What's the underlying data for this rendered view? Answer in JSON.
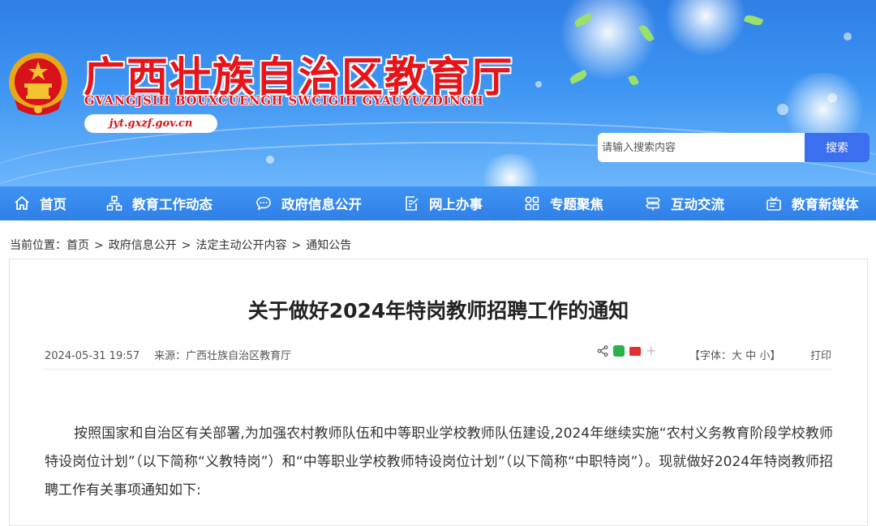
{
  "header": {
    "title": "广西壮族自治区教育厅",
    "subtitle": "GVANGJSIH BOUXCUENGH SWCIGIH GYAUYUZDINGH",
    "url": "jyt.gxzf.gov.cn"
  },
  "search": {
    "placeholder": "请输入搜索内容",
    "button_label": "搜索"
  },
  "nav": {
    "items": [
      {
        "label": "首页",
        "icon": "home-icon"
      },
      {
        "label": "教育工作动态",
        "icon": "network-icon"
      },
      {
        "label": "政府信息公开",
        "icon": "chat-bubble-icon"
      },
      {
        "label": "网上办事",
        "icon": "edit-document-icon"
      },
      {
        "label": "专题聚焦",
        "icon": "grid-icon"
      },
      {
        "label": "互动交流",
        "icon": "sign-icon"
      },
      {
        "label": "教育新媒体",
        "icon": "media-icon"
      }
    ]
  },
  "breadcrumb": {
    "prefix": "当前位置：",
    "items": [
      "首页",
      "政府信息公开",
      "法定主动公开内容",
      "通知公告"
    ],
    "separator": ">"
  },
  "article": {
    "title": "关于做好2024年特岗教师招聘工作的通知",
    "datetime": "2024-05-31 19:57",
    "source_label": "来源：",
    "source": "广西壮族自治区教育厅",
    "font_size_label": "【字体：",
    "font_large": "大",
    "font_medium": "中",
    "font_small": "小",
    "font_size_end": "】",
    "print_label": "打印",
    "body": "按照国家和自治区有关部署,为加强农村教师队伍和中等职业学校教师队伍建设,2024年继续实施“农村义务教育阶段学校教师特设岗位计划”（以下简称“义教特岗”）和“中等职业学校教师特设岗位计划”（以下简称“中职特岗”）。现就做好2024年特岗教师招聘工作有关事项通知如下:"
  },
  "colors": {
    "banner": "#3d94f2",
    "nav": "#2f80e8",
    "title_red": "#e8141a",
    "search_button": "#3b6ff0"
  }
}
